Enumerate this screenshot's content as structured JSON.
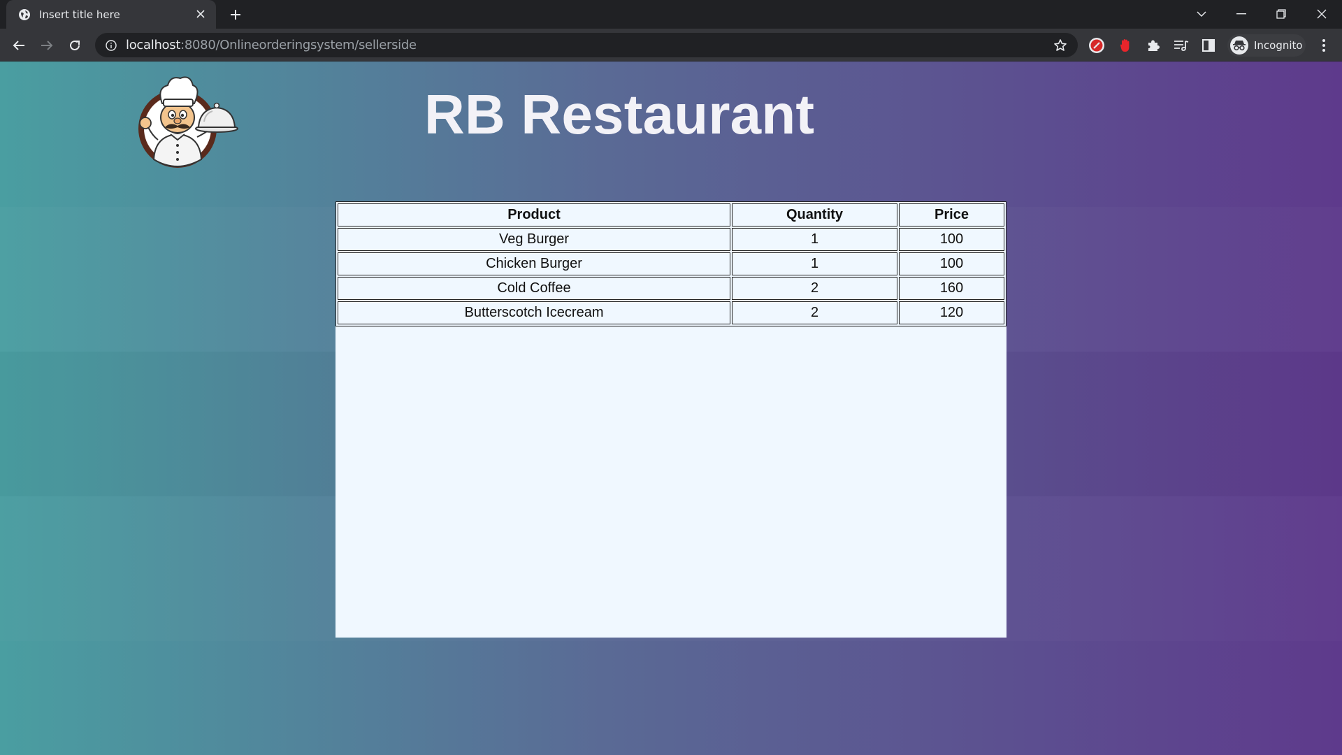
{
  "browser": {
    "tab_title": "Insert title here",
    "url_host": "localhost",
    "url_path": ":8080/Onlineorderingsystem/sellerside",
    "profile_label": "Incognito"
  },
  "page": {
    "title": "RB Restaurant",
    "logo_alt": "chef-logo"
  },
  "orders": {
    "columns": [
      "Product",
      "Quantity",
      "Price"
    ],
    "rows": [
      [
        "Veg Burger",
        "1",
        "100"
      ],
      [
        "Chicken Burger",
        "1",
        "100"
      ],
      [
        "Cold Coffee",
        "2",
        "160"
      ],
      [
        "Butterscotch Icecream",
        "2",
        "120"
      ]
    ]
  },
  "colors": {
    "gradient_start": "#4a9ea1",
    "gradient_end": "#5e3a8c",
    "panel_bg": "#f0f8ff",
    "title_text": "#f3f2f7"
  }
}
